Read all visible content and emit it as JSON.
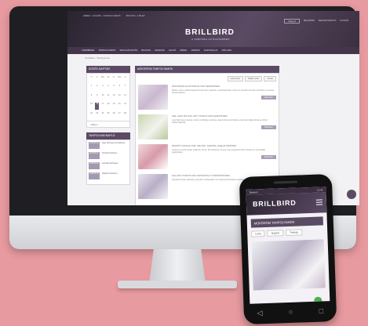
{
  "colors": {
    "background": "#e79aa0",
    "brand_purple": "#5a4a63",
    "header_dark": "#2a2430"
  },
  "desktop": {
    "topbar": [
      "HÍREK • AKCIÓK • TANFOLYAMOK",
      "BOLTOK • ÜZLET"
    ],
    "topbar_right": [
      "Magyar",
      "BELÉPÉS",
      "REGISZTRÁCIÓ",
      "KOSÁR"
    ],
    "logo": "BRILLBIRD",
    "logo_sub": "A SZÉPSÉG AZ ÉLETEDBEN",
    "nav": [
      "TERMÉKEK",
      "TANFOLYAMOK",
      "SZOLGÁLTATÁS",
      "BOLTOK",
      "MÁRKÁK",
      "AKCIÓ",
      "HÍREK",
      "VIDEÓK",
      "KAPCSOLAT",
      "RÓLUNK"
    ],
    "breadcrumb": "Kezdőlap › Tanfolyamok",
    "calendar_title": "KÖZÉS NAPTÁR",
    "calendar_days": [
      "H",
      "K",
      "Sze",
      "Cs",
      "P",
      "Szo",
      "V",
      "1",
      "2",
      "3",
      "4",
      "5",
      "6",
      "7",
      "8",
      "9",
      "10",
      "11",
      "12",
      "13",
      "14",
      "15",
      "16",
      "17",
      "18",
      "19",
      "20",
      "21",
      "22",
      "23",
      "24",
      "25",
      "26",
      "27",
      "28"
    ],
    "calendar_nav": "‹  Május  ›",
    "upcoming_title": "TANFOLYAM NAPLÓ",
    "upcoming": [
      {
        "date": "2018.05.05",
        "text": "Alap tanfolyam kezdőknek"
      },
      {
        "date": "2018.05.07",
        "text": "Díszítő tanfolyam"
      },
      {
        "date": "2018.05.09",
        "text": "Gél lakk tanfolyam"
      },
      {
        "date": "2018.05.12",
        "text": "Haladó tanfolyam"
      }
    ],
    "main_title": "MŰKÖRÖM TANFOLYAMOK",
    "view_buttons": [
      "Lista nézet",
      "Naptár nézet",
      "Térkép"
    ],
    "courses": [
      {
        "title": "MŰKÖRÖM ALAPTANFOLYAM KEZDŐKNEK",
        "text": "Minden, amit a műkörömépítésről tudni kell: anatómia, eszközhasználat, zselés és porcelán technika, formázás és reszelés lépésről lépésre.",
        "more": "Bővebben"
      },
      {
        "title": "GÉL LAKK ÉS NAIL ART TANFOLYAM KEZDŐKNEK",
        "text": "A gél lakk helyes felvitele, tartós és hibátlan eredmény, alap díszítési technikák a szalonban dolgozóknak és otthoni felhasználóknak.",
        "more": "Bővebben"
      },
      {
        "title": "DÍSZÍTŐ TANFOLYAM: MINTÁK, FESTÉS, ZSELÉ DÍSZÍTÉS",
        "text": "Festett és zselés minták, csillámok, kövek, 3D díszítések. Ismerd meg a legnépszerűbb trendeket és technikákat gyakorlatban.",
        "more": "Bővebben"
      },
      {
        "title": "HALADÓ TANFOLYAM TAPASZTALT KÖRMÖSÖKNEK",
        "text": "Speciális formák, javítások, gyorsabb munkavégzés és professzionális tippek a hatékonyabb szalonmunkához.",
        "more": "Bővebben"
      }
    ]
  },
  "phone": {
    "status_left": "Telekom",
    "status_right": "12:45",
    "logo": "BRILLBIRD",
    "title": "MŰKÖRÖM TANFOLYAMOK",
    "buttons": [
      "Lista",
      "Naptár",
      "Térkép"
    ],
    "nav_icons": [
      "back-icon",
      "home-icon",
      "recents-icon"
    ]
  }
}
